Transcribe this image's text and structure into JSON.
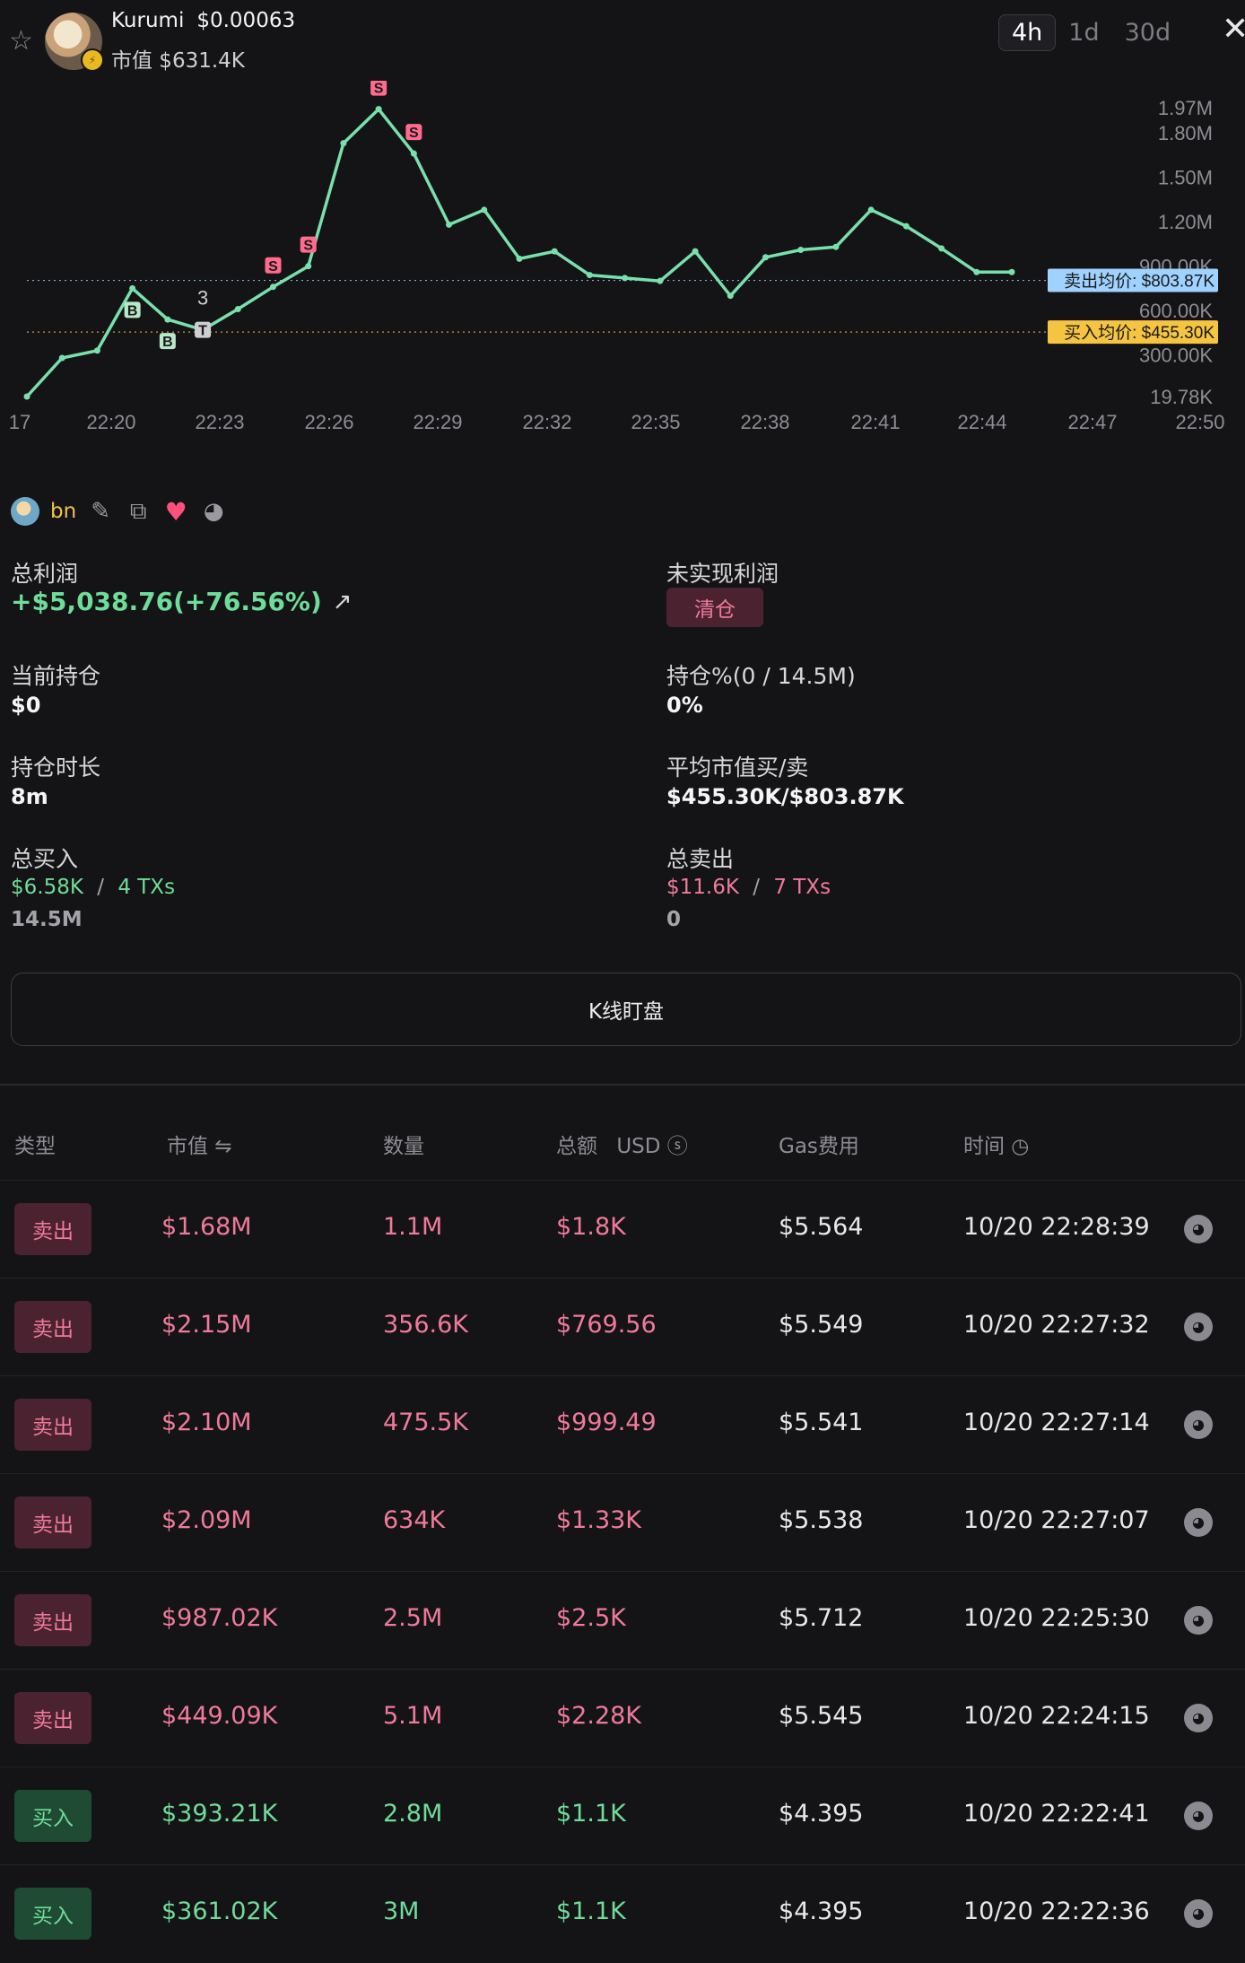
{
  "header": {
    "token_name": "Kurumi",
    "price": "$0.00063",
    "market_cap": "市值 $631.4K",
    "timeframes": [
      "4h",
      "1d",
      "30d"
    ],
    "active_timeframe": "4h",
    "star_icon": "star-icon",
    "close_icon": "close-icon"
  },
  "chart_data": {
    "type": "line",
    "x_ticks": [
      "17",
      "22:20",
      "22:23",
      "22:26",
      "22:29",
      "22:32",
      "22:35",
      "22:38",
      "22:41",
      "22:44",
      "22:47",
      "22:50"
    ],
    "y_ticks": [
      "1.97M",
      "1.80M",
      "1.50M",
      "1.20M",
      "900.00K",
      "600.00K",
      "300.00K",
      "19.78K"
    ],
    "ylim": [
      19780,
      1970000
    ],
    "series": [
      {
        "values": [
          20000,
          280000,
          330000,
          750000,
          540000,
          470000,
          610000,
          760000,
          900000,
          1730000,
          1960000,
          1660000,
          1180000,
          1280000,
          950000,
          1000000,
          840000,
          820000,
          800000,
          1000000,
          700000,
          960000,
          1010000,
          1030000,
          1280000,
          1170000,
          1020000,
          860000,
          860000
        ]
      }
    ],
    "line_color": "#79e0ad",
    "reference_lines": [
      {
        "label": "卖出均价: $803.87K",
        "value": 803870,
        "color": "#9fd2ff"
      },
      {
        "label": "买入均价: $455.30K",
        "value": 455300,
        "color": "#f5c542"
      }
    ],
    "markers": [
      {
        "label": "B",
        "index": 3,
        "kind": "buy"
      },
      {
        "label": "B",
        "index": 4,
        "kind": "buy"
      },
      {
        "label": "T",
        "index": 5,
        "kind": "transfer"
      },
      {
        "label": "3",
        "index": 5,
        "kind": "count"
      },
      {
        "label": "S",
        "index": 7,
        "kind": "sell"
      },
      {
        "label": "S",
        "index": 8,
        "kind": "sell"
      },
      {
        "label": "S",
        "index": 10,
        "kind": "sell"
      },
      {
        "label": "S",
        "index": 11,
        "kind": "sell"
      }
    ],
    "grid": false
  },
  "wallet": {
    "name": "bn",
    "icons": [
      "edit-icon",
      "copy-icon",
      "heart-icon",
      "chart-icon"
    ]
  },
  "stats": {
    "total_profit_label": "总利润",
    "total_profit_value": "+$5,038.76(+76.56%)",
    "unrealized_label": "未实现利润",
    "clear_button": "清仓",
    "position_label": "当前持仓",
    "position_value": "$0",
    "position_pct_label": "持仓%(0 / 14.5M)",
    "position_pct_value": "0%",
    "hold_time_label": "持仓时长",
    "hold_time_value": "8m",
    "avg_mc_label": "平均市值买/卖",
    "avg_mc_value": "$455.30K/$803.87K",
    "total_buy_label": "总买入",
    "total_buy_amount": "$6.58K",
    "total_buy_sep": "/",
    "total_buy_txs": "4 TXs",
    "total_buy_qty": "14.5M",
    "total_sell_label": "总卖出",
    "total_sell_amount": "$11.6K",
    "total_sell_sep": "/",
    "total_sell_txs": "7 TXs",
    "total_sell_qty": "0"
  },
  "kline_button": "K线盯盘",
  "table": {
    "headers": {
      "type": "类型",
      "mcap": "市值 ⇋",
      "qty": "数量",
      "total": "总额",
      "total_unit": "USD ⓢ",
      "gas": "Gas费用",
      "time": "时间 ◷"
    },
    "rows": [
      {
        "type": "卖出",
        "side": "sell",
        "mcap": "$1.68M",
        "qty": "1.1M",
        "total": "$1.8K",
        "gas": "$5.564",
        "time": "10/20 22:28:39"
      },
      {
        "type": "卖出",
        "side": "sell",
        "mcap": "$2.15M",
        "qty": "356.6K",
        "total": "$769.56",
        "gas": "$5.549",
        "time": "10/20 22:27:32"
      },
      {
        "type": "卖出",
        "side": "sell",
        "mcap": "$2.10M",
        "qty": "475.5K",
        "total": "$999.49",
        "gas": "$5.541",
        "time": "10/20 22:27:14"
      },
      {
        "type": "卖出",
        "side": "sell",
        "mcap": "$2.09M",
        "qty": "634K",
        "total": "$1.33K",
        "gas": "$5.538",
        "time": "10/20 22:27:07"
      },
      {
        "type": "卖出",
        "side": "sell",
        "mcap": "$987.02K",
        "qty": "2.5M",
        "total": "$2.5K",
        "gas": "$5.712",
        "time": "10/20 22:25:30"
      },
      {
        "type": "卖出",
        "side": "sell",
        "mcap": "$449.09K",
        "qty": "5.1M",
        "total": "$2.28K",
        "gas": "$5.545",
        "time": "10/20 22:24:15"
      },
      {
        "type": "买入",
        "side": "buy",
        "mcap": "$393.21K",
        "qty": "2.8M",
        "total": "$1.1K",
        "gas": "$4.395",
        "time": "10/20 22:22:41"
      },
      {
        "type": "买入",
        "side": "buy",
        "mcap": "$361.02K",
        "qty": "3M",
        "total": "$1.1K",
        "gas": "$4.395",
        "time": "10/20 22:22:36"
      }
    ]
  },
  "colors": {
    "sell": "#f07a9b",
    "buy": "#6fdc9a",
    "background": "#141416"
  }
}
